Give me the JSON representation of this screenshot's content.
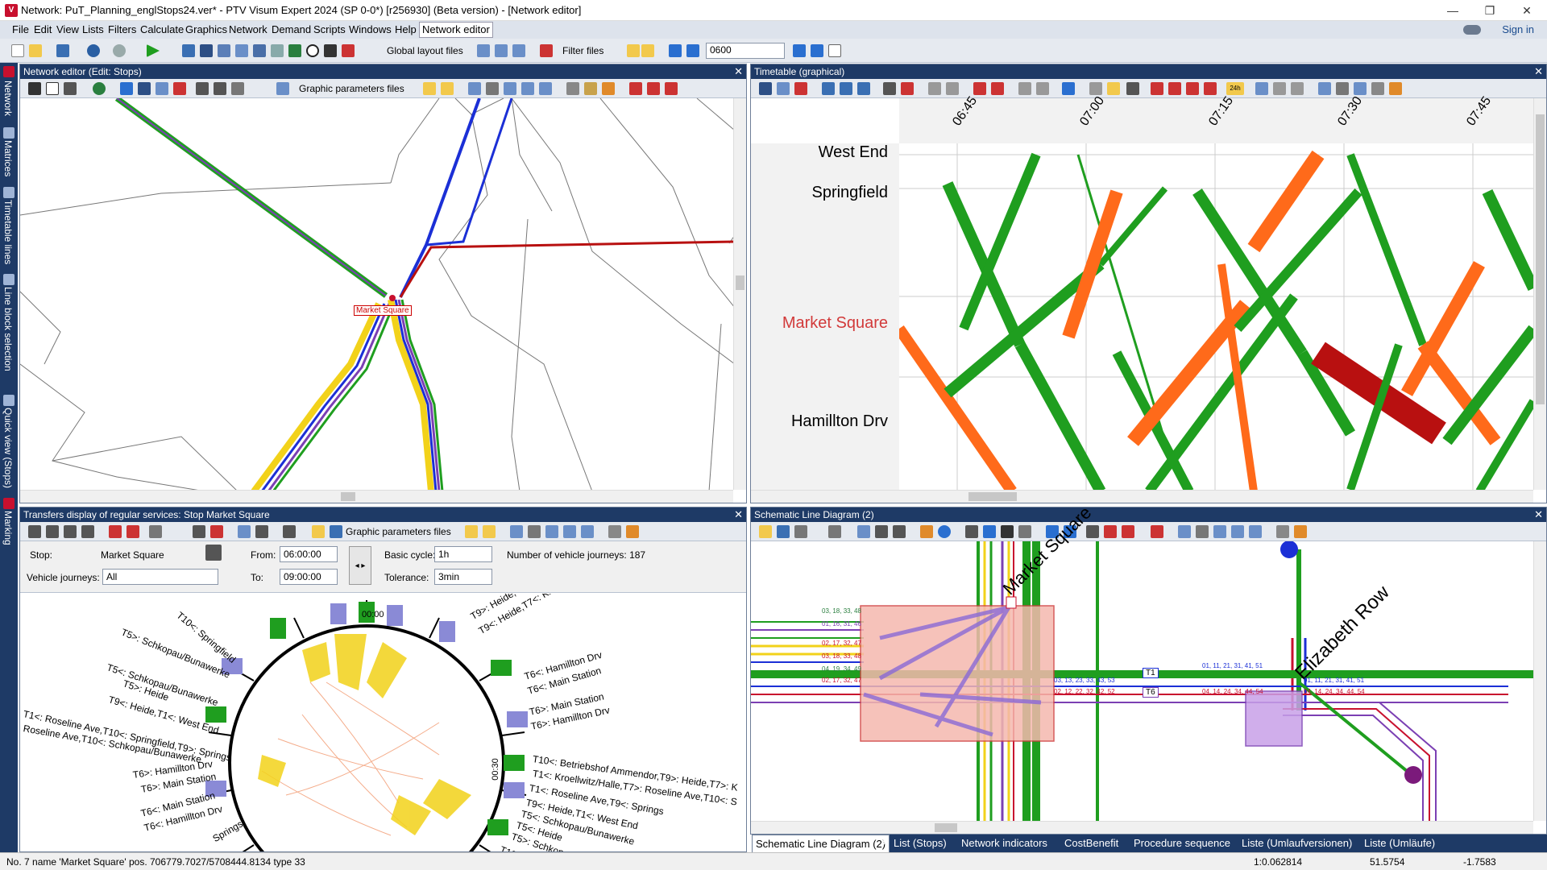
{
  "window": {
    "title": "Network: PuT_Planning_englStops24.ver* - PTV Visum Expert 2024 (SP 0-0*) [r256930] (Beta version) - [Network editor]",
    "minimize": "—",
    "maximize": "❐",
    "close": "✕"
  },
  "menu": {
    "items": [
      "File",
      "Edit",
      "View",
      "Lists",
      "Filters",
      "Calculate",
      "Graphics",
      "Network",
      "Demand",
      "Scripts",
      "Windows",
      "Help",
      "Network editor"
    ],
    "signin": "Sign in"
  },
  "toolbar": {
    "layout_label": "Global layout files",
    "filter_label": "Filter files",
    "time_value": "0600"
  },
  "sidebar": {
    "tabs": [
      "Network",
      "Matrices",
      "Timetable lines",
      "Line block selection",
      "Quick view (Stops)",
      "Marking"
    ]
  },
  "panes": {
    "network_editor": {
      "title": "Network editor (Edit: Stops)",
      "gp_label": "Graphic parameters files",
      "stop_label": "Market Square"
    },
    "timetable": {
      "title": "Timetable (graphical)",
      "times": [
        "06:45",
        "07:00",
        "07:15",
        "07:30",
        "07:45"
      ],
      "stops": [
        "West End",
        "Springfield",
        "Market Square",
        "Hamillton Drv"
      ],
      "btn_24h": "24h"
    },
    "transfers": {
      "title": "Transfers display of regular services: Stop Market Square",
      "gp_label": "Graphic parameters files",
      "stop_label": "Stop:",
      "stop_value": "Market Square",
      "vj_label": "Vehicle journeys:",
      "vj_value": "All",
      "from_label": "From:",
      "from_value": "06:00:00",
      "to_label": "To:",
      "to_value": "09:00:00",
      "cycle_label": "Basic cycle:",
      "cycle_value": "1h",
      "tol_label": "Tolerance:",
      "tol_value": "3min",
      "count_label": "Number of vehicle journeys: 187",
      "clock_label": "00:00",
      "clock_label_r": "00:30",
      "left_labels": [
        "T5>: Schkopau/Bunawerke",
        "T10<: Springfield",
        "T5<: Schkopau/Bunawerke",
        "T5>: Heide",
        "T9<: Heide,T1<: West End",
        "T1<: Roseline Ave,T10<: Springfield,T9>: Springs",
        "Roseline Ave,T10<: Schkopau/Bunawerke",
        "T6>: Hamillton Drv",
        "T6>: Main Station",
        "T6<: Main Station",
        "T6<: Hamillton Drv",
        "Springs"
      ],
      "right_labels": [
        "T9>: Heide,T7>: Ro",
        "T9<: Heide,T7<: Kr",
        "T6<: Hamillton Drv",
        "T6<: Main Station",
        "T6>: Main Station",
        "T6>: Hamillton Drv",
        "T10<: Betriebshof Ammendor,T9>: Heide,T7>: K",
        "T1<: Kroellwitz/Halle,T7>: Roseline Ave,T10<: S",
        "T1<: Roseline Ave,T9<: Springs",
        "T9<: Heide,T1<: West End",
        "T5<: Schkopau/Bunawerke",
        "T5<: Heide",
        "T5>: Schkopau/Bunawerke",
        "T10>: Sc"
      ]
    },
    "schematic": {
      "title": "Schematic Line Diagram (2)",
      "stop1": "Market Square",
      "stop2": "Elizabeth Row",
      "badge1": "T1",
      "badge2": "T6",
      "nums": [
        "03, 18, 33, 48",
        "01, 16, 31, 46",
        "02, 17, 32, 47",
        "03, 18, 33, 48",
        "04, 19, 34, 49",
        "02, 17, 32, 47",
        "03, 13, 23, 33, 43, 53",
        "02, 12, 22, 32, 42, 52",
        "01, 11, 21, 31, 41, 51",
        "04, 14, 24, 34, 44, 54",
        "01, 11, 21, 31, 41, 51",
        "04, 14, 24, 34, 44, 54"
      ]
    }
  },
  "bottom_tabs": [
    "Schematic Line Diagram (2)",
    "List (Stops)",
    "Network indicators",
    "CostBenefit",
    "Procedure sequence",
    "Liste (Umlaufversionen)",
    "Liste (Umläufe)"
  ],
  "status": {
    "info": "No. 7  name 'Market Square'  pos. 706779.7027/5708444.8134  type 33",
    "scale": "1:0.062814",
    "x": "51.5754",
    "y": "-1.7583"
  },
  "colors": {
    "chrome": "#1e3a66",
    "accent": "#c8102e",
    "green": "#1f9e1f",
    "orange": "#ff6a1a",
    "darkred": "#b81010"
  }
}
